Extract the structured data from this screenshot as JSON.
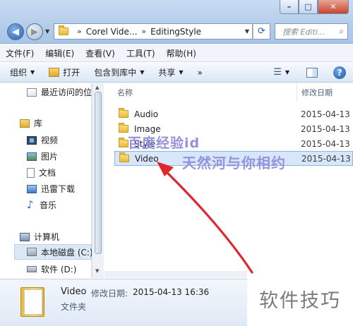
{
  "window": {
    "min_label": "–",
    "max_label": "□",
    "close_label": "✕"
  },
  "address": {
    "crumbs": [
      "Corel Vide...",
      "EditingStyle"
    ],
    "separator": "»",
    "search_placeholder": "搜索 Editi..."
  },
  "menu": [
    "文件(F)",
    "编辑(E)",
    "查看(V)",
    "工具(T)",
    "帮助(H)"
  ],
  "toolbar": {
    "organize": "组织",
    "open": "打开",
    "include": "包含到库中",
    "share": "共享",
    "more": "»"
  },
  "nav": {
    "recent": "最近访问的位",
    "library": "库",
    "videos": "视频",
    "pictures": "图片",
    "documents": "文档",
    "thunder": "迅雷下载",
    "music": "音乐",
    "computer": "计算机",
    "disk_c": "本地磁盘 (C:)",
    "disk_d": "软件 (D:)"
  },
  "columns": {
    "name": "名称",
    "date": "修改日期"
  },
  "files": [
    {
      "name": "Audio",
      "date": "2015-04-13"
    },
    {
      "name": "Image",
      "date": "2015-04-13"
    },
    {
      "name": "Style",
      "date": "2015-04-13"
    },
    {
      "name": "Video",
      "date": "2015-04-13"
    }
  ],
  "watermarks": {
    "line1": "百度经验id",
    "line2": "天然河与你相约"
  },
  "details": {
    "name": "Video",
    "date_label": "修改日期:",
    "date_value": "2015-04-13 16:36",
    "type": "文件夹"
  },
  "brand": "软件技巧",
  "colors": {
    "arrow": "#e0262c",
    "selection": "#d7e6f8",
    "accent": "#2b62b1"
  },
  "icons": [
    "back-arrow-icon",
    "forward-arrow-icon",
    "folder-icon",
    "refresh-icon",
    "search-icon",
    "help-icon",
    "music-note-icon"
  ]
}
